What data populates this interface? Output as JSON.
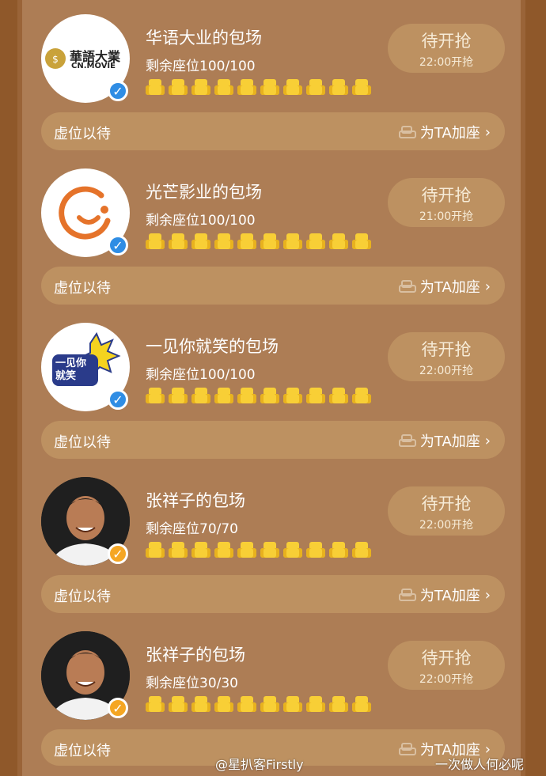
{
  "colors": {
    "outer_bg": "#8f582a",
    "panel_bg": "#ad7d55",
    "pill_bg": "#bd9161",
    "seat_yellow": "#f8cf36",
    "verified_blue": "#2f8de4",
    "verified_orange": "#f5a623"
  },
  "cards": [
    {
      "name": "华语大业的包场",
      "seats_text": "剩余座位100/100",
      "status": "待开抢",
      "time": "22:00开抢",
      "wait_label": "虚位以待",
      "add_label": "为TA加座",
      "avatar_text": "華語大業",
      "avatar_sub": "CN.MOVIE",
      "badge": "blue"
    },
    {
      "name": "光芒影业的包场",
      "seats_text": "剩余座位100/100",
      "status": "待开抢",
      "time": "21:00开抢",
      "wait_label": "虚位以待",
      "add_label": "为TA加座",
      "badge": "blue"
    },
    {
      "name": "一见你就笑的包场",
      "seats_text": "剩余座位100/100",
      "status": "待开抢",
      "time": "22:00开抢",
      "wait_label": "虚位以待",
      "add_label": "为TA加座",
      "avatar_text": "一见你就笑",
      "badge": "blue"
    },
    {
      "name": "张祥子的包场",
      "seats_text": "剩余座位70/70",
      "status": "待开抢",
      "time": "22:00开抢",
      "wait_label": "虚位以待",
      "add_label": "为TA加座",
      "badge": "orange"
    },
    {
      "name": "张祥子的包场",
      "seats_text": "剩余座位30/30",
      "status": "待开抢",
      "time": "22:00开抢",
      "wait_label": "虚位以待",
      "add_label": "为TA加座",
      "badge": "orange"
    }
  ],
  "watermark": {
    "text": "@星扒客Firstly",
    "text2": "一次做人何必呢"
  }
}
